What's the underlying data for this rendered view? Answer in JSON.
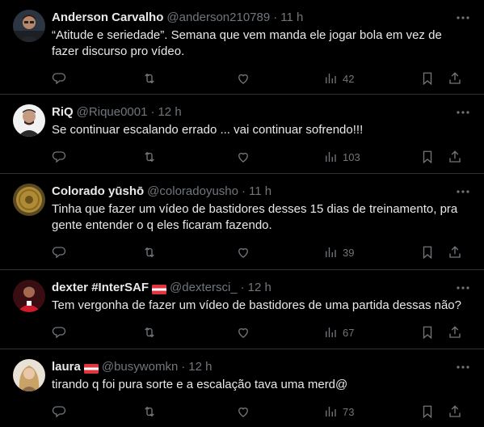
{
  "tweets": [
    {
      "name": "Anderson Carvalho",
      "handle": "@anderson210789",
      "sep": "·",
      "time": "11 h",
      "text": "“Atitude e seriedade”. Semana que vem manda ele jogar bola em vez de fazer discurso pro vídeo.",
      "views": "42",
      "flag": false,
      "avatar_color": "#3b4b5c"
    },
    {
      "name": "RiQ",
      "handle": "@Rique0001",
      "sep": "·",
      "time": "12 h",
      "text": "Se continuar escalando errado ... vai continuar sofrendo!!!",
      "views": "103",
      "flag": false,
      "avatar_color": "#d9d9d9"
    },
    {
      "name": "Colorado yūshō",
      "handle": "@coloradoyusho",
      "sep": "·",
      "time": "11 h",
      "text": "Tinha que fazer um vídeo de bastidores desses 15 dias de treinamento, pra gente entender o q eles ficaram fazendo.",
      "views": "39",
      "flag": false,
      "avatar_color": "#a37d2a"
    },
    {
      "name": "dexter #InterSAF",
      "handle": "@dextersci_",
      "sep": "·",
      "time": "12 h",
      "text": "Tem vergonha de fazer um vídeo de bastidores de uma partida dessas não?",
      "views": "67",
      "flag": true,
      "avatar_color": "#c4182b"
    },
    {
      "name": "laura",
      "handle": "@busywomkn",
      "sep": "·",
      "time": "12 h",
      "text": "tirando q foi pura sorte e a escalação tava uma merd@",
      "views": "73",
      "flag": true,
      "avatar_color": "#c9b89a"
    }
  ],
  "colors": {
    "background": "#000000",
    "text": "#e7e9ea",
    "secondary": "#71767b",
    "divider": "#2f3336",
    "flag_red": "#e1343f"
  }
}
